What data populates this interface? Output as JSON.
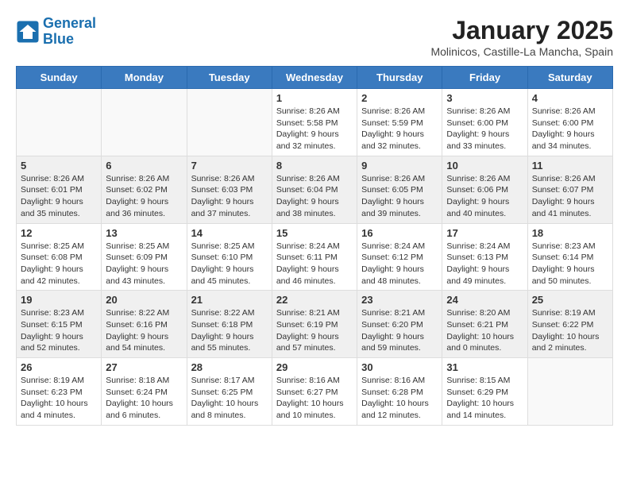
{
  "logo": {
    "line1": "General",
    "line2": "Blue"
  },
  "title": "January 2025",
  "subtitle": "Molinicos, Castille-La Mancha, Spain",
  "weekdays": [
    "Sunday",
    "Monday",
    "Tuesday",
    "Wednesday",
    "Thursday",
    "Friday",
    "Saturday"
  ],
  "weeks": [
    [
      {
        "day": "",
        "info": ""
      },
      {
        "day": "",
        "info": ""
      },
      {
        "day": "",
        "info": ""
      },
      {
        "day": "1",
        "info": "Sunrise: 8:26 AM\nSunset: 5:58 PM\nDaylight: 9 hours and 32 minutes."
      },
      {
        "day": "2",
        "info": "Sunrise: 8:26 AM\nSunset: 5:59 PM\nDaylight: 9 hours and 32 minutes."
      },
      {
        "day": "3",
        "info": "Sunrise: 8:26 AM\nSunset: 6:00 PM\nDaylight: 9 hours and 33 minutes."
      },
      {
        "day": "4",
        "info": "Sunrise: 8:26 AM\nSunset: 6:00 PM\nDaylight: 9 hours and 34 minutes."
      }
    ],
    [
      {
        "day": "5",
        "info": "Sunrise: 8:26 AM\nSunset: 6:01 PM\nDaylight: 9 hours and 35 minutes."
      },
      {
        "day": "6",
        "info": "Sunrise: 8:26 AM\nSunset: 6:02 PM\nDaylight: 9 hours and 36 minutes."
      },
      {
        "day": "7",
        "info": "Sunrise: 8:26 AM\nSunset: 6:03 PM\nDaylight: 9 hours and 37 minutes."
      },
      {
        "day": "8",
        "info": "Sunrise: 8:26 AM\nSunset: 6:04 PM\nDaylight: 9 hours and 38 minutes."
      },
      {
        "day": "9",
        "info": "Sunrise: 8:26 AM\nSunset: 6:05 PM\nDaylight: 9 hours and 39 minutes."
      },
      {
        "day": "10",
        "info": "Sunrise: 8:26 AM\nSunset: 6:06 PM\nDaylight: 9 hours and 40 minutes."
      },
      {
        "day": "11",
        "info": "Sunrise: 8:26 AM\nSunset: 6:07 PM\nDaylight: 9 hours and 41 minutes."
      }
    ],
    [
      {
        "day": "12",
        "info": "Sunrise: 8:25 AM\nSunset: 6:08 PM\nDaylight: 9 hours and 42 minutes."
      },
      {
        "day": "13",
        "info": "Sunrise: 8:25 AM\nSunset: 6:09 PM\nDaylight: 9 hours and 43 minutes."
      },
      {
        "day": "14",
        "info": "Sunrise: 8:25 AM\nSunset: 6:10 PM\nDaylight: 9 hours and 45 minutes."
      },
      {
        "day": "15",
        "info": "Sunrise: 8:24 AM\nSunset: 6:11 PM\nDaylight: 9 hours and 46 minutes."
      },
      {
        "day": "16",
        "info": "Sunrise: 8:24 AM\nSunset: 6:12 PM\nDaylight: 9 hours and 48 minutes."
      },
      {
        "day": "17",
        "info": "Sunrise: 8:24 AM\nSunset: 6:13 PM\nDaylight: 9 hours and 49 minutes."
      },
      {
        "day": "18",
        "info": "Sunrise: 8:23 AM\nSunset: 6:14 PM\nDaylight: 9 hours and 50 minutes."
      }
    ],
    [
      {
        "day": "19",
        "info": "Sunrise: 8:23 AM\nSunset: 6:15 PM\nDaylight: 9 hours and 52 minutes."
      },
      {
        "day": "20",
        "info": "Sunrise: 8:22 AM\nSunset: 6:16 PM\nDaylight: 9 hours and 54 minutes."
      },
      {
        "day": "21",
        "info": "Sunrise: 8:22 AM\nSunset: 6:18 PM\nDaylight: 9 hours and 55 minutes."
      },
      {
        "day": "22",
        "info": "Sunrise: 8:21 AM\nSunset: 6:19 PM\nDaylight: 9 hours and 57 minutes."
      },
      {
        "day": "23",
        "info": "Sunrise: 8:21 AM\nSunset: 6:20 PM\nDaylight: 9 hours and 59 minutes."
      },
      {
        "day": "24",
        "info": "Sunrise: 8:20 AM\nSunset: 6:21 PM\nDaylight: 10 hours and 0 minutes."
      },
      {
        "day": "25",
        "info": "Sunrise: 8:19 AM\nSunset: 6:22 PM\nDaylight: 10 hours and 2 minutes."
      }
    ],
    [
      {
        "day": "26",
        "info": "Sunrise: 8:19 AM\nSunset: 6:23 PM\nDaylight: 10 hours and 4 minutes."
      },
      {
        "day": "27",
        "info": "Sunrise: 8:18 AM\nSunset: 6:24 PM\nDaylight: 10 hours and 6 minutes."
      },
      {
        "day": "28",
        "info": "Sunrise: 8:17 AM\nSunset: 6:25 PM\nDaylight: 10 hours and 8 minutes."
      },
      {
        "day": "29",
        "info": "Sunrise: 8:16 AM\nSunset: 6:27 PM\nDaylight: 10 hours and 10 minutes."
      },
      {
        "day": "30",
        "info": "Sunrise: 8:16 AM\nSunset: 6:28 PM\nDaylight: 10 hours and 12 minutes."
      },
      {
        "day": "31",
        "info": "Sunrise: 8:15 AM\nSunset: 6:29 PM\nDaylight: 10 hours and 14 minutes."
      },
      {
        "day": "",
        "info": ""
      }
    ]
  ]
}
